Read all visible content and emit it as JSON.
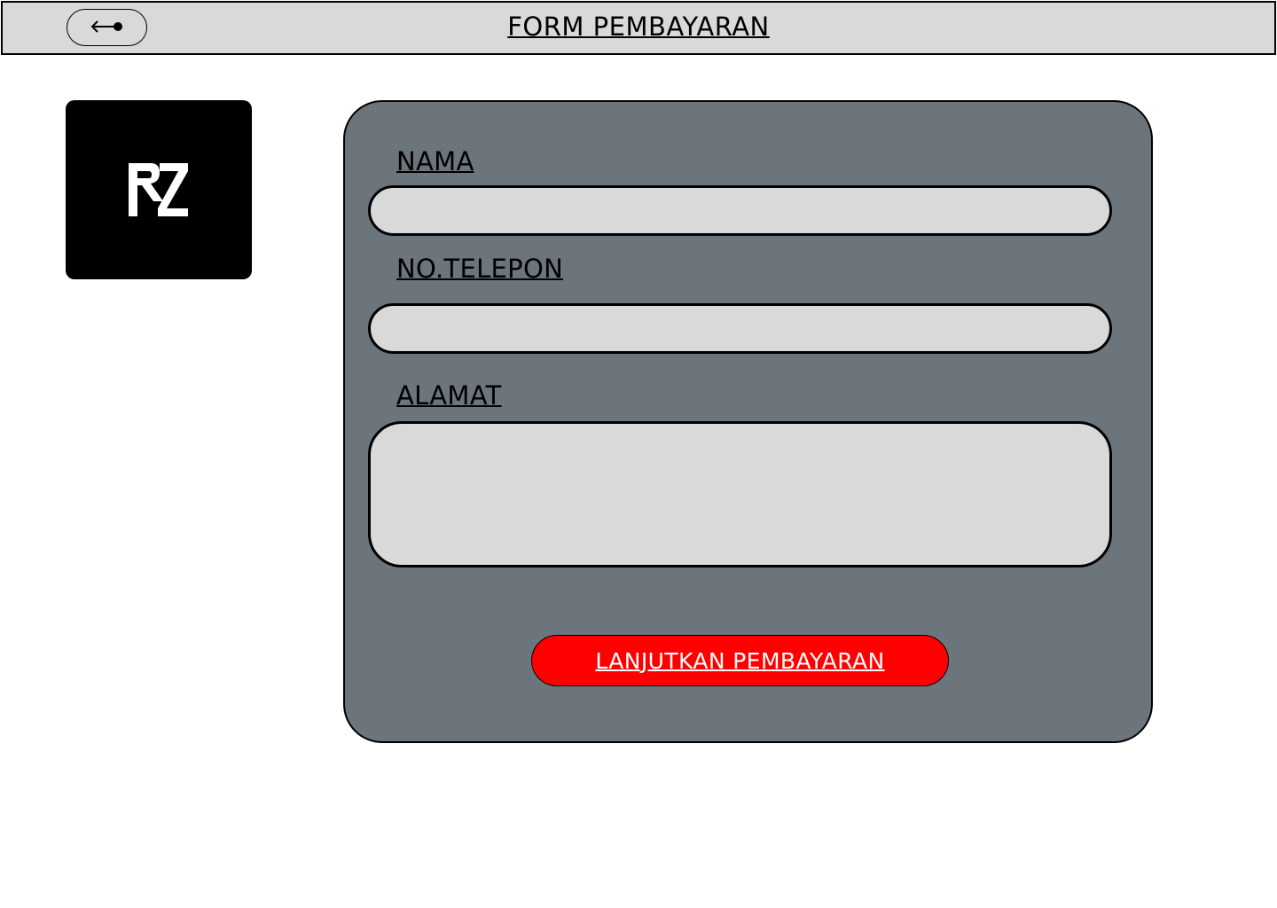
{
  "header": {
    "title": "FORM PEMBAYARAN",
    "back_icon": "back-arrow-icon"
  },
  "logo": {
    "text": "RZ",
    "colors": {
      "background": "#000000",
      "foreground": "#ffffff"
    }
  },
  "form": {
    "fields": [
      {
        "label": "NAMA",
        "value": "",
        "placeholder": ""
      },
      {
        "label": "NO.TELEPON",
        "value": "",
        "placeholder": ""
      },
      {
        "label": "ALAMAT",
        "value": "",
        "placeholder": ""
      }
    ],
    "submit_label": "LANJUTKAN PEMBAYARAN"
  },
  "colors": {
    "header_bg": "#d9d9d9",
    "panel_bg": "#6c747c",
    "field_bg": "#d9d9d9",
    "submit_bg": "#ff0000",
    "submit_text": "#ffffff"
  }
}
